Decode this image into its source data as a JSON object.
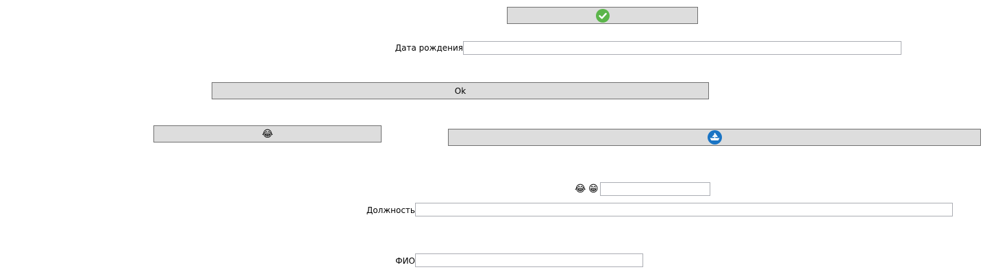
{
  "buttons": {
    "ok_label": "Ok",
    "laugh_symbol": "😂"
  },
  "fields": {
    "birthdate_label": "Дата рождения",
    "birthdate_value": "",
    "position_label": "Должность",
    "position_value": "",
    "fio_label": "ФИО",
    "fio_value": "",
    "emoji_field_value": ""
  },
  "emoji_labels": {
    "laugh": "😂",
    "grin": "😁"
  },
  "colors": {
    "check_icon": "#5bb54a",
    "boat_icon": "#1a74c4",
    "button_face": "#dddddd",
    "button_border": "#707070",
    "field_border": "#abadb3"
  },
  "icons": [
    "check-circle-icon",
    "laughing-face-icon",
    "boat-icon",
    "grinning-face-icon"
  ]
}
